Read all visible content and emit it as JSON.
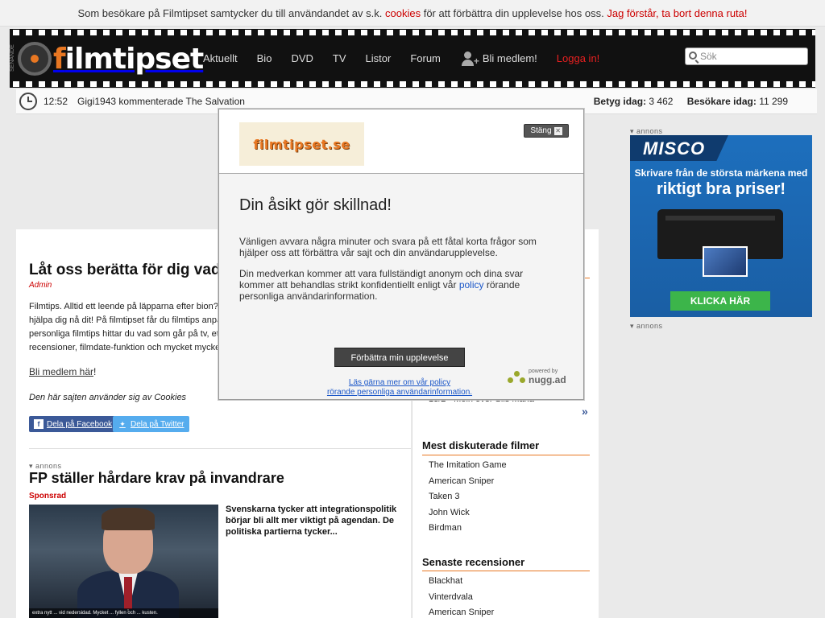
{
  "cookie_bar": {
    "text_before": "Som besökare på Filmtipset samtycker du till användandet av s.k.",
    "link_cookies": "cookies",
    "text_after": "för att förbättra din upplevelse hos oss.",
    "dismiss": "Jag förstår, ta bort denna ruta!"
  },
  "header": {
    "side_label": "SENANDE",
    "logo_f": "f",
    "logo_rest": "ilmtipset",
    "nav": [
      "Aktuellt",
      "Bio",
      "DVD",
      "TV",
      "Listor",
      "Forum"
    ],
    "member": "Bli medlem!",
    "login": "Logga in!",
    "search_placeholder": "Sök"
  },
  "infobar": {
    "time": "12:52",
    "activity": "Gigi1943 kommenterade The Salvation",
    "rating_label": "Betyg idag:",
    "rating_value": "3 462",
    "visitors_label": "Besökare idag:",
    "visitors_value": "11 299"
  },
  "main": {
    "title": "Låt oss berätta för dig vad d",
    "author": "Admin",
    "intro": "Filmtips. Alltid ett leende på läpparna efter bion? ... hjälpa dig nå dit! På filmtipset får du filmtips anpa... personliga filmtips hittar du vad som går på tv, et... recensioner, filmdate-funktion och mycket mycke...",
    "intro_lines": [
      "Filmtips. Alltid ett leende på läpparna efter bion?",
      "hjälpa dig nå dit! På filmtipset får du filmtips anpa",
      "personliga filmtips hittar du vad som går på tv, et",
      "recensioner, filmdate-funktion och mycket mycke"
    ],
    "member_link": "Bli medlem här",
    "member_suffix": "!",
    "cookies_note": "Den här sajten använder sig av Cookies",
    "share_fb": "Dela på Facebook",
    "share_tw": "Dela på Twitter",
    "ad_label": "annons",
    "article_title": "FP ställer hårdare krav på invandrare",
    "sponsor": "Sponsrad",
    "article_text": "Svenskarna tycker att integrationspolitik börjar bli allt mer viktigt på agendan. De politiska partierna tycker...",
    "photo_caption": "extra nytt  ... vid nedersidad. Mycket ... fyllen och ... kusten."
  },
  "side": {
    "movie_line": "13/2 - Moln över Sils Maria",
    "most_discussed_title": "Mest diskuterade filmer",
    "most_discussed": [
      "The Imitation Game",
      "American Sniper",
      "Taken 3",
      "John Wick",
      "Birdman"
    ],
    "latest_reviews_title": "Senaste recensioner",
    "latest_reviews": [
      "Blackhat",
      "Vinterdvala",
      "American Sniper"
    ]
  },
  "right_ad": {
    "label_top": "annons",
    "label_bottom": "annons",
    "brand": "MISCO",
    "line1": "Skrivare från de största märkena med",
    "line2": "riktigt bra priser!",
    "cta": "KLICKA HÄR"
  },
  "modal": {
    "logo": "filmtipset.se",
    "close": "Stäng",
    "heading": "Din åsikt gör skillnad!",
    "p1": "Vänligen avvara några minuter och svara på ett fåtal korta frågor som hjälper oss att förbättra vår sajt och din användarupplevelse.",
    "p2_before": "Din medverkan kommer att vara fullständigt anonym och dina svar kommer att behandlas strikt konfidentiellt enligt vår",
    "p2_link": "policy",
    "p2_after": "rörande personliga användarinformation.",
    "improve_button": "Förbättra min upplevelse",
    "policy_line1": "Läs gärna mer om vår policy",
    "policy_line2": "rörande personliga användarinformation.",
    "powered_by": "powered by",
    "nugg": "nugg.ad"
  }
}
